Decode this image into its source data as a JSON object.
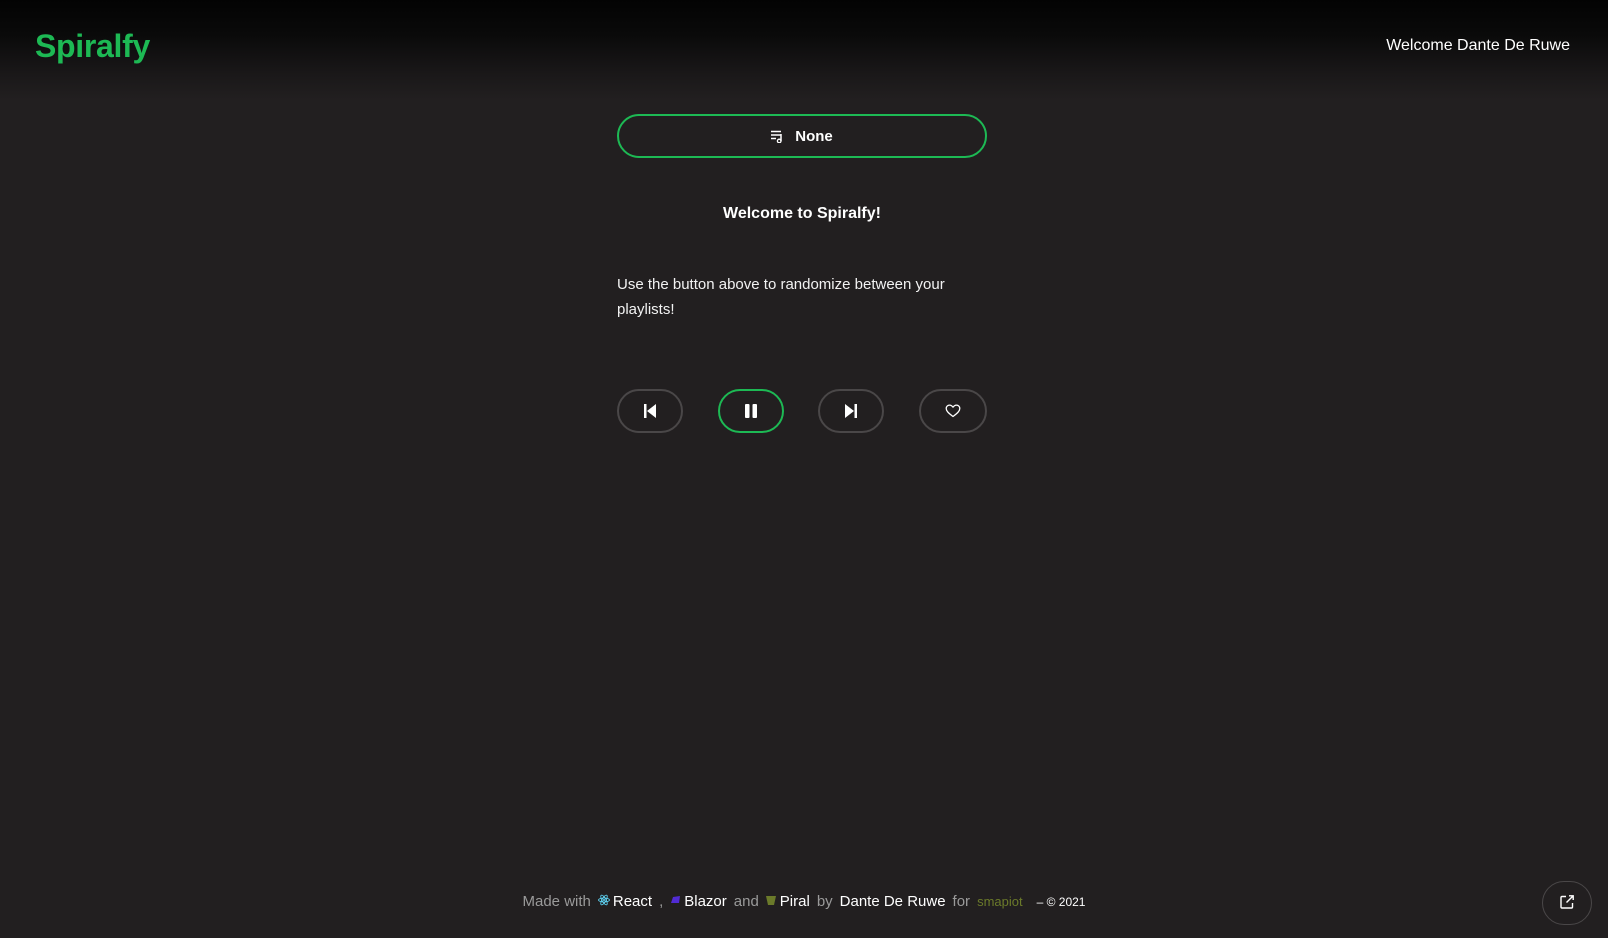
{
  "header": {
    "logo": "Spiralfy",
    "welcome_user": "Welcome Dante De Ruwe"
  },
  "main": {
    "playlist_button": {
      "icon": "playlist-icon",
      "label": "None"
    },
    "welcome_title": "Welcome to Spiralfy!",
    "instructions": "Use the button above to randomize between your playlists!"
  },
  "controls": [
    {
      "name": "previous-button",
      "icon": "skip-previous-icon"
    },
    {
      "name": "pause-button",
      "icon": "pause-icon",
      "active": true
    },
    {
      "name": "next-button",
      "icon": "skip-next-icon"
    },
    {
      "name": "like-button",
      "icon": "heart-icon"
    }
  ],
  "footer": {
    "made_with": "Made with",
    "react": "React",
    "comma": ",",
    "blazor": "Blazor",
    "and": "and",
    "piral": "Piral",
    "by": "by",
    "author": "Dante De Ruwe",
    "for": "for",
    "company": "smapiot",
    "copyright": "– © 2021"
  },
  "fab": {
    "icon": "external-link-icon"
  },
  "colors": {
    "accent": "#1db954",
    "background": "#221f20",
    "border": "#4a4748"
  }
}
